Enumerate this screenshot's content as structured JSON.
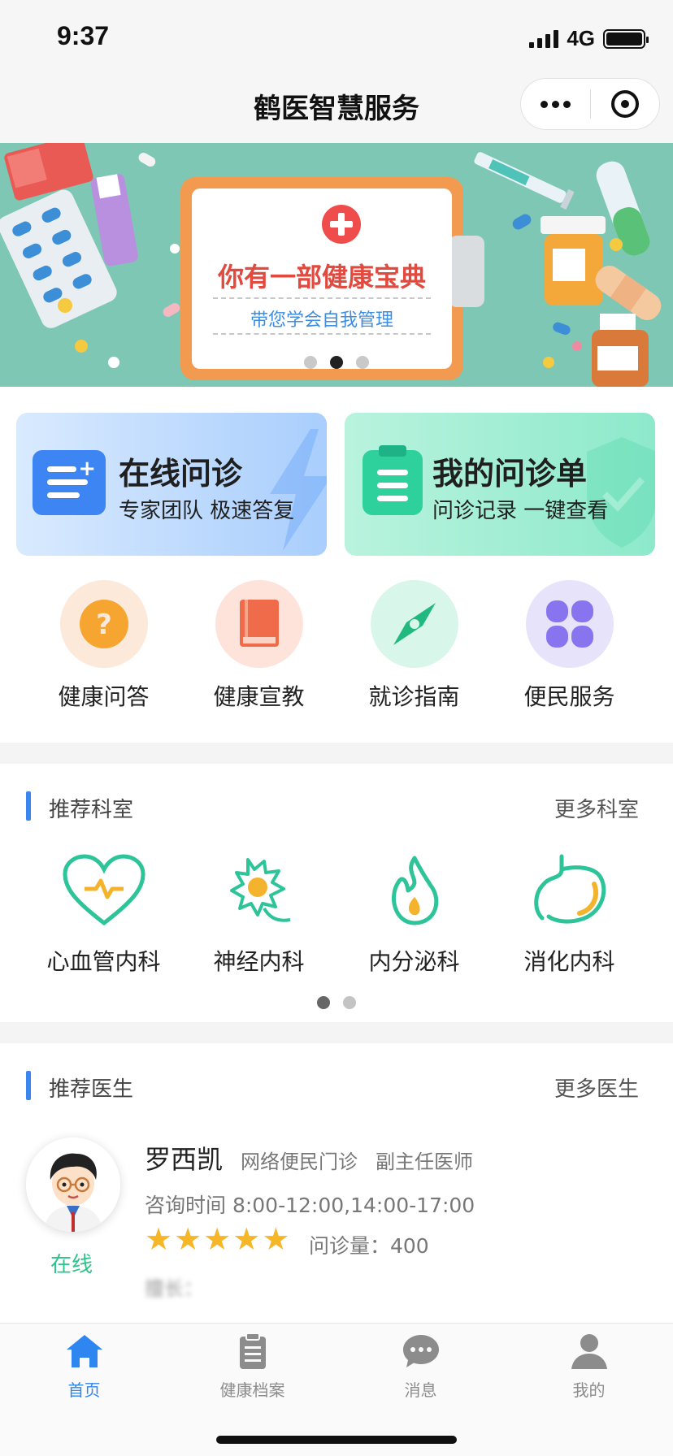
{
  "status_bar": {
    "time": "9:37",
    "network": "4G"
  },
  "nav": {
    "title": "鹤医智慧服务"
  },
  "banner": {
    "title": "你有一部健康宝典",
    "subtitle": "带您学会自我管理",
    "slide_count": 3,
    "active_slide": 2
  },
  "cards": [
    {
      "title": "在线问诊",
      "subtitle": "专家团队 极速答复"
    },
    {
      "title": "我的问诊单",
      "subtitle": "问诊记录 一键查看"
    }
  ],
  "shortcuts": [
    {
      "label": "健康问答",
      "icon": "question-icon",
      "bg": "#fde9da",
      "color": "#f5a530"
    },
    {
      "label": "健康宣教",
      "icon": "book-icon",
      "bg": "#fde3da",
      "color": "#ef6b4a"
    },
    {
      "label": "就诊指南",
      "icon": "compass-icon",
      "bg": "#d9f6ea",
      "color": "#22b980"
    },
    {
      "label": "便民服务",
      "icon": "grid-icon",
      "bg": "#e7e3fb",
      "color": "#8874ef"
    }
  ],
  "departments": {
    "title": "推荐科室",
    "more": "更多科室",
    "items": [
      {
        "label": "心血管内科",
        "icon": "heart-icon"
      },
      {
        "label": "神经内科",
        "icon": "neuron-icon"
      },
      {
        "label": "内分泌科",
        "icon": "flame-icon"
      },
      {
        "label": "消化内科",
        "icon": "stomach-icon"
      }
    ],
    "page_count": 2,
    "active_page": 1
  },
  "doctors": {
    "title": "推荐医生",
    "more": "更多医生",
    "doctor": {
      "name": "罗西凯",
      "clinic": "网络便民门诊",
      "title": "副主任医师",
      "time": "咨询时间 8:00-12:00,14:00-17:00",
      "rating": 5,
      "consult_count": "问诊量：400",
      "status": "在线",
      "skill_label": "擅长："
    }
  },
  "tab_bar": {
    "tabs": [
      {
        "label": "首页",
        "icon": "home-icon",
        "active": true
      },
      {
        "label": "健康档案",
        "icon": "clipboard-icon",
        "active": false
      },
      {
        "label": "消息",
        "icon": "message-icon",
        "active": false
      },
      {
        "label": "我的",
        "icon": "user-icon",
        "active": false
      }
    ]
  },
  "colors": {
    "accent": "#2f86f0",
    "green": "#2cc48a",
    "star": "#f6b628",
    "banner_bg": "#7ec7b4"
  }
}
